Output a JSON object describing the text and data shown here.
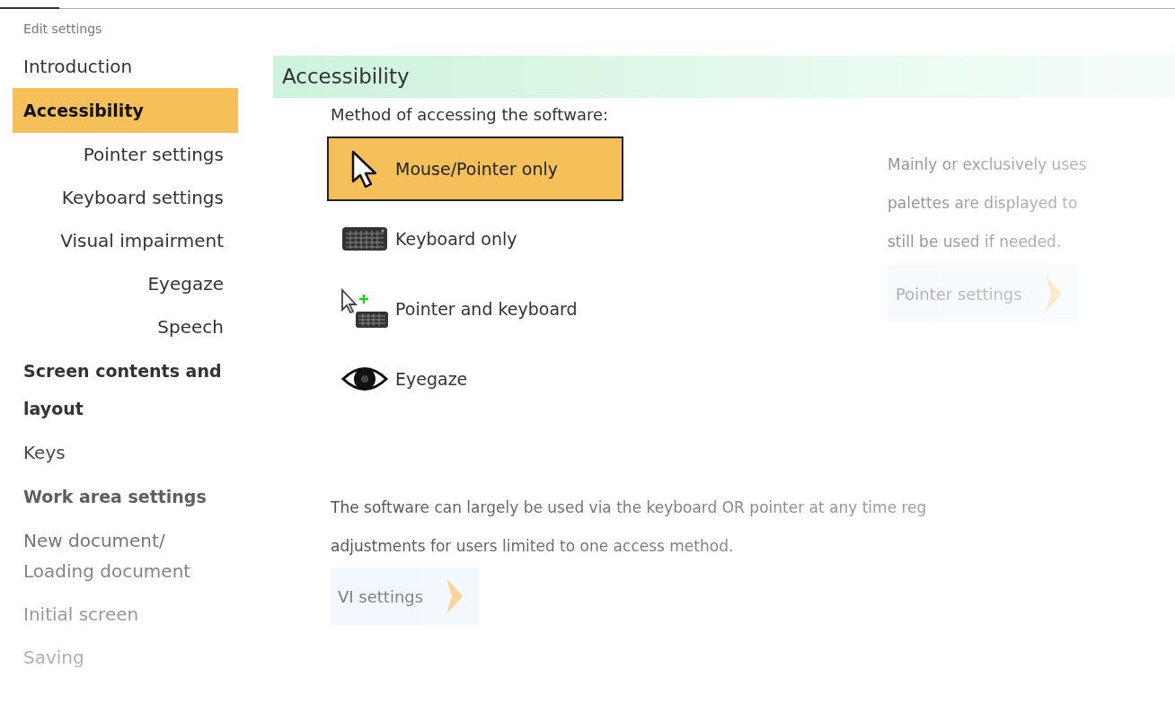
{
  "header": {
    "title": "Edit settings"
  },
  "sidebar": {
    "items": [
      {
        "label": "Introduction",
        "kind": "link",
        "selected": false
      },
      {
        "label": "Accessibility",
        "kind": "section",
        "selected": true,
        "children": [
          {
            "label": "Pointer settings",
            "selected": false
          },
          {
            "label": "Keyboard settings",
            "selected": false
          },
          {
            "label": "Visual impairment",
            "selected": false,
            "children": [
              {
                "label": "Eyegaze",
                "selected": false
              },
              {
                "label": "Speech",
                "selected": false
              }
            ]
          }
        ]
      },
      {
        "label": "Screen contents and layout",
        "kind": "section",
        "selected": false
      },
      {
        "label": "Keys",
        "kind": "link",
        "selected": false
      },
      {
        "label": "Work area settings",
        "kind": "section",
        "selected": false
      },
      {
        "label": "New document/ Loading document",
        "kind": "link",
        "selected": false
      },
      {
        "label": "Initial screen",
        "kind": "link",
        "selected": false
      },
      {
        "label": "Saving",
        "kind": "link",
        "selected": false
      }
    ]
  },
  "panel": {
    "title": "Accessibility",
    "prompt": "Method of accessing the software:",
    "options": [
      {
        "label": "Mouse/Pointer only",
        "kind": "pointer",
        "selected": true
      },
      {
        "label": "Keyboard only",
        "kind": "keyboard",
        "selected": false
      },
      {
        "label": "Pointer and keyboard",
        "kind": "pointer-keyboard",
        "selected": false
      },
      {
        "label": "Eyegaze",
        "kind": "eye",
        "selected": false
      }
    ],
    "description": {
      "lines": [
        "Mainly or exclusively uses",
        "palettes are displayed to",
        "still be used if needed."
      ],
      "button": "Pointer settings"
    },
    "note": {
      "lines": [
        "The software can largely be used via the keyboard OR pointer at any time reg",
        "adjustments for users limited to one access method."
      ],
      "button": "VI settings"
    }
  }
}
